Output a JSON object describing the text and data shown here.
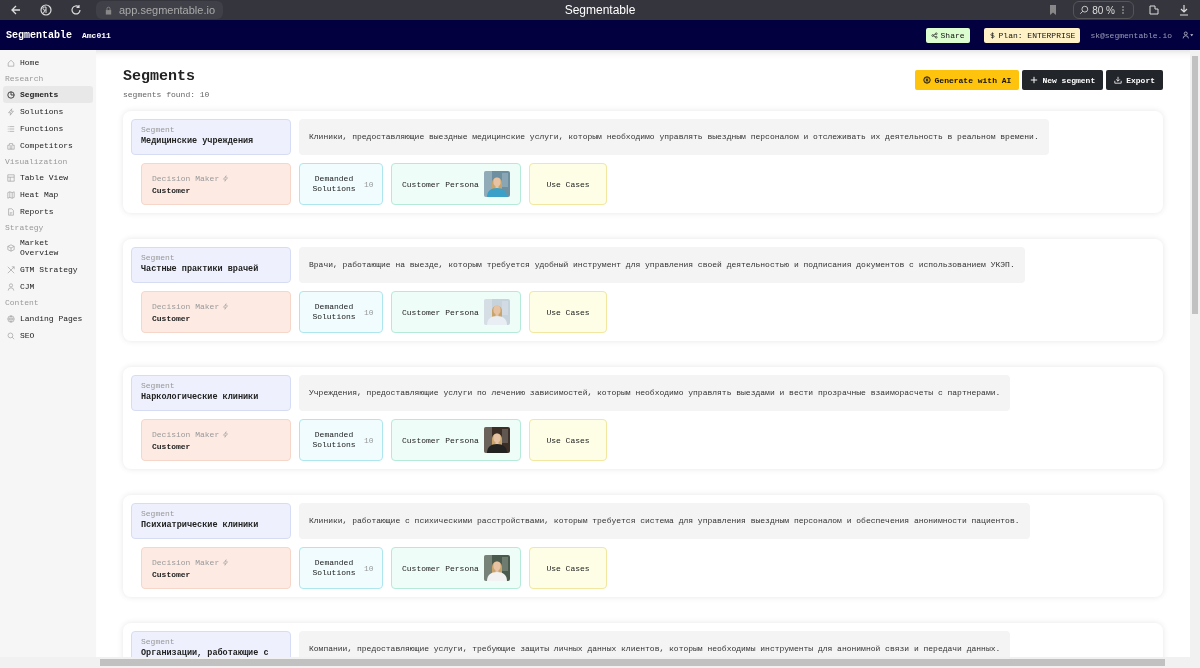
{
  "browser": {
    "url": "app.segmentable.io",
    "title": "Segmentable",
    "zoom": "80 %"
  },
  "header": {
    "brand": "Segmentable",
    "workspace": "Amc011",
    "share": "Share",
    "plan": "Plan: ENTERPRISE",
    "email": "sk@segmentable.io"
  },
  "sidebar": {
    "items": [
      {
        "kind": "item",
        "label": "Home",
        "selected": false
      },
      {
        "kind": "section",
        "label": "Research"
      },
      {
        "kind": "item",
        "label": "Segments",
        "selected": true
      },
      {
        "kind": "item",
        "label": "Solutions",
        "selected": false
      },
      {
        "kind": "item",
        "label": "Functions",
        "selected": false
      },
      {
        "kind": "item",
        "label": "Competitors",
        "selected": false
      },
      {
        "kind": "section",
        "label": "Visualization"
      },
      {
        "kind": "item",
        "label": "Table View",
        "selected": false
      },
      {
        "kind": "item",
        "label": "Heat Map",
        "selected": false
      },
      {
        "kind": "item",
        "label": "Reports",
        "selected": false
      },
      {
        "kind": "section",
        "label": "Strategy"
      },
      {
        "kind": "item",
        "label": "Market Overview",
        "selected": false
      },
      {
        "kind": "item",
        "label": "GTM Strategy",
        "selected": false
      },
      {
        "kind": "item",
        "label": "CJM",
        "selected": false
      },
      {
        "kind": "section",
        "label": "Content"
      },
      {
        "kind": "item",
        "label": "Landing Pages",
        "selected": false
      },
      {
        "kind": "item",
        "label": "SEO",
        "selected": false
      }
    ]
  },
  "page": {
    "title": "Segments",
    "count": "segments found: 10",
    "buttons": [
      {
        "kind": "ai",
        "label": "Generate with AI"
      },
      {
        "kind": "new",
        "label": "New segment"
      },
      {
        "kind": "export",
        "label": "Export"
      }
    ]
  },
  "segments": [
    {
      "caption": "Segment",
      "name": "Медицинские учреждения",
      "description": "Клиники, предоставляющие выездные медицинские услуги, которым необходимо управлять выездным персоналом и отслеживать их деятельность в реальном времени.",
      "dm_label": "Decision Maker",
      "dm_value": "Customer",
      "solutions_label": "Demanded Solutions",
      "solutions_count": "10",
      "persona": "Customer Persona",
      "use_cases": "Use Cases"
    },
    {
      "caption": "Segment",
      "name": "Частные практики врачей",
      "description": "Врачи, работающие на выезде, которым требуется удобный инструмент для управления своей деятельностью и подписания документов с использованием УКЭП.",
      "dm_label": "Decision Maker",
      "dm_value": "Customer",
      "solutions_label": "Demanded Solutions",
      "solutions_count": "10",
      "persona": "Customer Persona",
      "use_cases": "Use Cases"
    },
    {
      "caption": "Segment",
      "name": "Наркологические клиники",
      "description": "Учреждения, предоставляющие услуги по лечению зависимостей, которым необходимо управлять выездами и вести прозрачные взаиморасчеты с партнерами.",
      "dm_label": "Decision Maker",
      "dm_value": "Customer",
      "solutions_label": "Demanded Solutions",
      "solutions_count": "10",
      "persona": "Customer Persona",
      "use_cases": "Use Cases"
    },
    {
      "caption": "Segment",
      "name": "Психиатрические клиники",
      "description": "Клиники, работающие с психическими расстройствами, которым требуется система для управления выездным персоналом и обеспечения анонимности пациентов.",
      "dm_label": "Decision Maker",
      "dm_value": "Customer",
      "solutions_label": "Demanded Solutions",
      "solutions_count": "10",
      "persona": "Customer Persona",
      "use_cases": "Use Cases"
    },
    {
      "caption": "Segment",
      "name": "Организации, работающие с",
      "description": "Компании, предоставляющие услуги, требующие защиты личных данных клиентов, которым необходимы инструменты для анонимной связи и передачи данных."
    }
  ]
}
